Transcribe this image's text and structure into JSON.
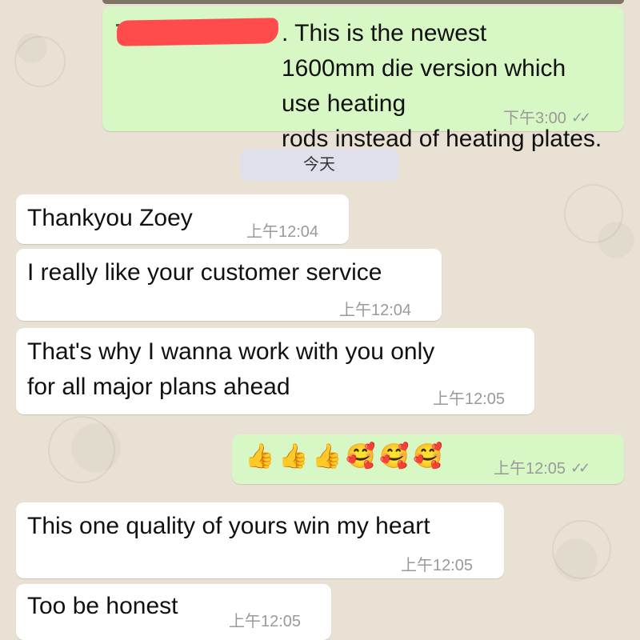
{
  "messages": {
    "m1": {
      "visible_text": ". This is the newest\n1600mm die version which use heating\nrods instead of heating plates.",
      "time": "下午3:00",
      "read_receipt_icon": "double-check-icon"
    },
    "date_separator": "今天",
    "m2": {
      "text": "Thankyou Zoey",
      "time": "上午12:04"
    },
    "m3": {
      "text": "I really like your customer service",
      "time": "上午12:04"
    },
    "m4": {
      "text": "That's why I wanna work with you only\nfor all major plans ahead",
      "time": "上午12:05"
    },
    "m5": {
      "emojis": [
        "👍",
        "👍",
        "👍",
        "🥰",
        "🥰",
        "🥰"
      ],
      "time": "上午12:05",
      "read_receipt_icon": "double-check-icon"
    },
    "m6": {
      "text": "This one quality of yours win my heart",
      "time": "上午12:05"
    },
    "m7": {
      "text": "Too be honest",
      "time": "上午12:05"
    }
  },
  "colors": {
    "incoming_bubble": "#ffffff",
    "outgoing_bubble": "#d7f7c4",
    "background": "#e8e1d4",
    "date_chip": "#dfe0eb",
    "redaction": "#ff4b4b"
  }
}
